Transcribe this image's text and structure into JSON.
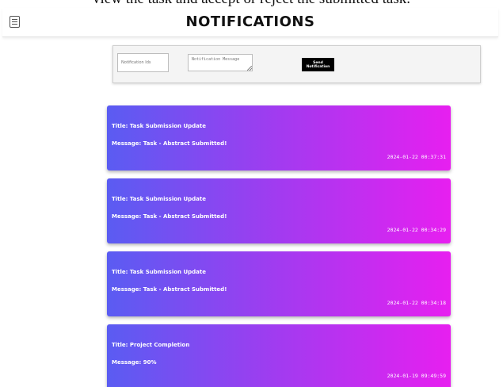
{
  "caption": "view the task and accept or reject the submitted task.",
  "header": {
    "title": "NOTIFICATIONS"
  },
  "form": {
    "ids_placeholder": "Notification Ids",
    "message_placeholder": "Notification Message",
    "send_label": "Send Notification"
  },
  "notifications": [
    {
      "title": "Title: Task Submission Update",
      "message": "Message: Task - Abstract Submitted!",
      "timestamp": "2024-01-22 00:37:31"
    },
    {
      "title": "Title: Task Submission Update",
      "message": "Message: Task - Abstract Submitted!",
      "timestamp": "2024-01-22 00:34:29"
    },
    {
      "title": "Title: Task Submission Update",
      "message": "Message: Task - Abstract Submitted!",
      "timestamp": "2024-01-22 00:34:18"
    },
    {
      "title": "Title: Project Completion",
      "message": "Message: 90%",
      "timestamp": "2024-01-19 09:49:59"
    }
  ],
  "colors": {
    "card_gradient_start": "#5a5cf2",
    "card_gradient_end": "#e71ff0",
    "send_button_bg": "#000000"
  }
}
